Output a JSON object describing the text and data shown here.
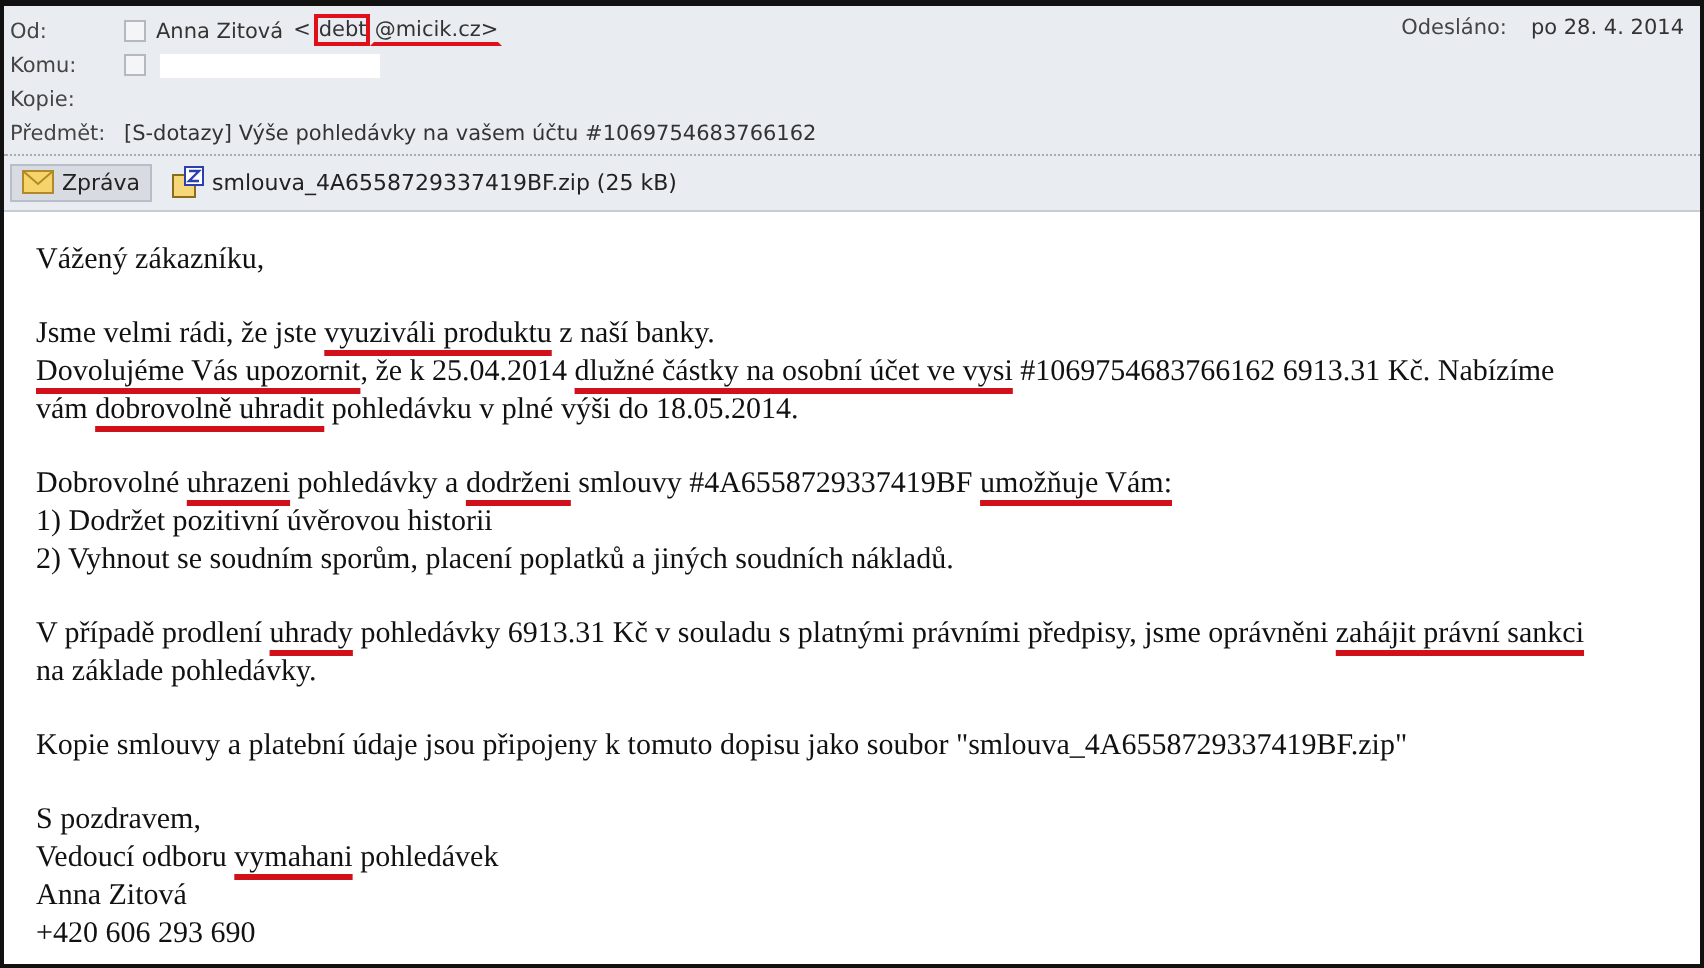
{
  "header": {
    "from": {
      "label": "Od:",
      "name": "Anna Zitová",
      "email": [
        {
          "text": "<",
          "boxed": false,
          "underlined": false
        },
        {
          "text": "debt",
          "boxed": true,
          "underlined": false
        },
        {
          "text": "@micik.cz>",
          "boxed": false,
          "underlined": true
        }
      ]
    },
    "to": {
      "label": "Komu:",
      "redacted": true
    },
    "cc": {
      "label": "Kopie:"
    },
    "subject": {
      "label": "Předmět:",
      "value": "[S-dotazy] Výše pohledávky na vašem účtu #1069754683766162"
    },
    "sent": {
      "label": "Odesláno:",
      "value": "po 28. 4. 2014"
    }
  },
  "tabs": [
    {
      "label": "Zpráva",
      "kind": "message",
      "selected": true
    },
    {
      "label": "smlouva_4A6558729337419BF.zip (25 kB)",
      "kind": "attachment",
      "selected": false
    }
  ],
  "body": [
    [
      [
        {
          "text": "Vážený zákazníku,",
          "underlined": false
        }
      ]
    ],
    [
      [
        {
          "text": "Jsme velmi rádi, že jste ",
          "underlined": false
        },
        {
          "text": "vyuziváli produktu",
          "underlined": true
        },
        {
          "text": " z naší banky.",
          "underlined": false
        }
      ],
      [
        {
          "text": "Dovolujéme Vás upozornit",
          "underlined": true
        },
        {
          "text": ", že k 25.04.2014 ",
          "underlined": false
        },
        {
          "text": "dlužné částky na osobní účet ve vysi",
          "underlined": true
        },
        {
          "text": " #1069754683766162 6913.31 Kč. Nabízíme",
          "underlined": false
        }
      ],
      [
        {
          "text": "vám ",
          "underlined": false
        },
        {
          "text": "dobrovolně uhradit",
          "underlined": true
        },
        {
          "text": " pohledávku v plné výši do 18.05.2014.",
          "underlined": false
        }
      ]
    ],
    [
      [
        {
          "text": "Dobrovolné ",
          "underlined": false
        },
        {
          "text": "uhrazeni",
          "underlined": true
        },
        {
          "text": " pohledávky a ",
          "underlined": false
        },
        {
          "text": "dodrženi",
          "underlined": true
        },
        {
          "text": " smlouvy #4A6558729337419BF ",
          "underlined": false
        },
        {
          "text": "umožňuje Vám:",
          "underlined": true
        }
      ],
      [
        {
          "text": "1) Dodržet pozitivní úvěrovou historii",
          "underlined": false
        }
      ],
      [
        {
          "text": "2) Vyhnout se soudním sporům, placení poplatků a jiných soudních nákladů.",
          "underlined": false
        }
      ]
    ],
    [
      [
        {
          "text": "V případě prodlení ",
          "underlined": false
        },
        {
          "text": "uhrady",
          "underlined": true
        },
        {
          "text": " pohledávky 6913.31 Kč v souladu s platnými právními předpisy, jsme oprávněni ",
          "underlined": false
        },
        {
          "text": "zahájit právní sankci",
          "underlined": true
        }
      ],
      [
        {
          "text": "na základe pohledávky.",
          "underlined": false
        }
      ]
    ],
    [
      [
        {
          "text": "Kopie smlouvy a platební údaje jsou připojeny k tomuto dopisu jako soubor \"smlouva_4A6558729337419BF.zip\"",
          "underlined": false
        }
      ]
    ],
    [
      [
        {
          "text": "S pozdravem,",
          "underlined": false
        }
      ],
      [
        {
          "text": "Vedoucí odboru ",
          "underlined": false
        },
        {
          "text": "vymahani",
          "underlined": true
        },
        {
          "text": " pohledávek",
          "underlined": false
        }
      ],
      [
        {
          "text": "Anna Zitová",
          "underlined": false
        }
      ],
      [
        {
          "text": "+420 606 293 690",
          "underlined": false
        }
      ]
    ]
  ]
}
